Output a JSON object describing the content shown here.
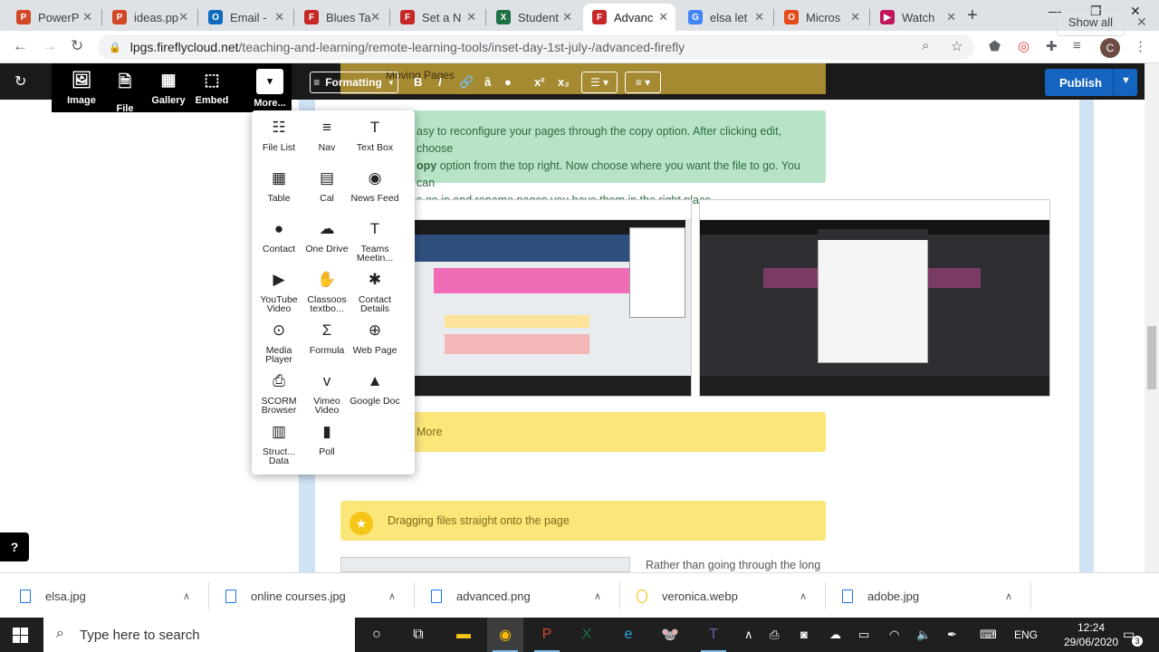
{
  "browser": {
    "tabs": [
      {
        "title": "PowerP",
        "icon": "powerpoint-icon",
        "color": "#d24726",
        "glyph": "P"
      },
      {
        "title": "ideas.pp",
        "icon": "powerpoint-icon",
        "color": "#d24726",
        "glyph": "P"
      },
      {
        "title": "Email -",
        "icon": "outlook-icon",
        "color": "#0f6cbd",
        "glyph": "O"
      },
      {
        "title": "Blues Ta",
        "icon": "firefly-icon",
        "color": "#c62828",
        "glyph": "F"
      },
      {
        "title": "Set a N",
        "icon": "firefly-icon",
        "color": "#c62828",
        "glyph": "F"
      },
      {
        "title": "Student",
        "icon": "excel-icon",
        "color": "#1e7145",
        "glyph": "X"
      },
      {
        "title": "Advanc",
        "icon": "firefly-icon",
        "color": "#c62828",
        "glyph": "F"
      },
      {
        "title": "elsa let",
        "icon": "google-icon",
        "color": "#4285f4",
        "glyph": "G"
      },
      {
        "title": "Micros",
        "icon": "office-icon",
        "color": "#e64a19",
        "glyph": "O"
      },
      {
        "title": "Watch",
        "icon": "stream-icon",
        "color": "#c2185b",
        "glyph": "▶"
      }
    ],
    "active_tab": 6,
    "new_tab": "+",
    "url_host": "lpgs.fireflycloud.net",
    "url_path": "/teaching-and-learning/remote-learning-tools/inset-day-1st-july-/advanced-firefly",
    "avatar_letter": "C"
  },
  "editor": {
    "buttons": [
      {
        "label": "Image",
        "icon": "image-icon",
        "glyph": "🖼"
      },
      {
        "label": "File",
        "icon": "file-icon",
        "glyph": "🗎"
      },
      {
        "label": "Gallery",
        "icon": "gallery-icon",
        "glyph": "▦"
      },
      {
        "label": "Embed",
        "icon": "embed-icon",
        "glyph": "⬚"
      }
    ],
    "more_label": "More...",
    "more_glyph": "▾",
    "formatting_label": "Formatting",
    "publish_label": "Publish",
    "undo_glyph": "↻"
  },
  "more_menu": {
    "items": [
      {
        "label": "File List",
        "icon": "file-list-icon",
        "glyph": "☷"
      },
      {
        "label": "Nav",
        "icon": "nav-icon",
        "glyph": "≡"
      },
      {
        "label": "Text Box",
        "icon": "text-box-icon",
        "glyph": "T"
      },
      {
        "label": "Table",
        "icon": "table-icon",
        "glyph": "▦"
      },
      {
        "label": "Cal",
        "icon": "calendar-icon",
        "glyph": "▤"
      },
      {
        "label": "News Feed",
        "icon": "rss-icon",
        "glyph": "◉"
      },
      {
        "label": "Contact",
        "icon": "person-icon",
        "glyph": "●"
      },
      {
        "label": "One Drive",
        "icon": "onedrive-icon",
        "glyph": "☁"
      },
      {
        "label": "Teams Meetin...",
        "icon": "teams-icon",
        "glyph": "T"
      },
      {
        "label": "YouTube Video",
        "icon": "youtube-icon",
        "glyph": "▶"
      },
      {
        "label": "Classoos textbo...",
        "icon": "hand-icon",
        "glyph": "✋"
      },
      {
        "label": "Contact Details",
        "icon": "puzzle-icon",
        "glyph": "✱"
      },
      {
        "label": "Media Player",
        "icon": "media-player-icon",
        "glyph": "⊙"
      },
      {
        "label": "Formula",
        "icon": "sigma-icon",
        "glyph": "Σ"
      },
      {
        "label": "Web Page",
        "icon": "globe-icon",
        "glyph": "⊕"
      },
      {
        "label": "SCORM Browser",
        "icon": "scorm-icon",
        "glyph": "⎙"
      },
      {
        "label": "Vimeo Video",
        "icon": "vimeo-icon",
        "glyph": "v"
      },
      {
        "label": "Google Doc",
        "icon": "google-drive-icon",
        "glyph": "▲"
      },
      {
        "label": "Struct... Data",
        "icon": "structured-data-icon",
        "glyph": "▥"
      },
      {
        "label": "Poll",
        "icon": "poll-icon",
        "glyph": "▮"
      }
    ]
  },
  "content": {
    "top_header_fragment": "Moving Pages",
    "green_text_l1": "asy to reconfigure your pages through the copy option.  After clicking edit, choose",
    "green_text_l2_bold": "opy",
    "green_text_l2": " option from the top right.  Now choose where you want the file to go. You can",
    "green_text_l3": "s go in and rename pages you have them in the right place",
    "more_header": "More",
    "drag_header": "Dragging files straight onto the page",
    "rather_text": "Rather than going through the long"
  },
  "downloads": {
    "items": [
      "elsa.jpg",
      "online courses.jpg",
      "advanced.png",
      "veronica.webp",
      "adobe.jpg"
    ],
    "show_all": "Show all"
  },
  "taskbar": {
    "search_placeholder": "Type here to search",
    "language": "ENG",
    "time": "12:24",
    "date": "29/06/2020",
    "notification_count": "3"
  }
}
